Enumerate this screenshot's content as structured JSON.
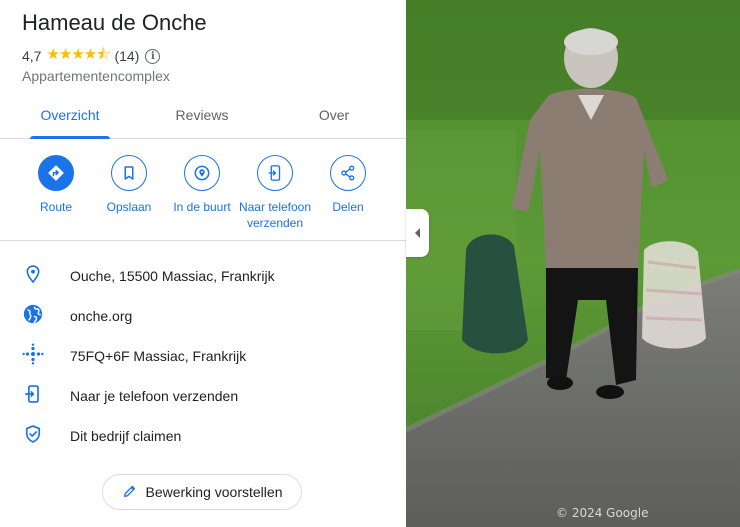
{
  "place": {
    "title": "Hameau de Onche",
    "rating": "4,7",
    "stars": "★★★★⯪",
    "review_count": "(14)",
    "category": "Appartementencomplex"
  },
  "tabs": [
    {
      "label": "Overzicht",
      "active": true
    },
    {
      "label": "Reviews",
      "active": false
    },
    {
      "label": "Over",
      "active": false
    }
  ],
  "actions": [
    {
      "label": "Route",
      "icon": "directions-icon"
    },
    {
      "label": "Opslaan",
      "icon": "bookmark-icon"
    },
    {
      "label": "In de buurt",
      "icon": "nearby-icon"
    },
    {
      "label": "Naar telefoon verzenden",
      "icon": "send-to-phone-icon"
    },
    {
      "label": "Delen",
      "icon": "share-icon"
    }
  ],
  "info": {
    "address": "Ouche, 15500 Massiac, Frankrijk",
    "website": "onche.org",
    "plus_code": "75FQ+6F Massiac, Frankrijk",
    "send_to_phone": "Naar je telefoon verzenden",
    "claim": "Dit bedrijf claimen"
  },
  "suggest_edit": "Bewerking voorstellen",
  "photo": {
    "watermark": "© 2024 Google"
  },
  "colors": {
    "accent": "#1a73e8",
    "star": "#fbbc04",
    "text": "#202124",
    "secondary": "#70757a",
    "divider": "#dadce0"
  }
}
